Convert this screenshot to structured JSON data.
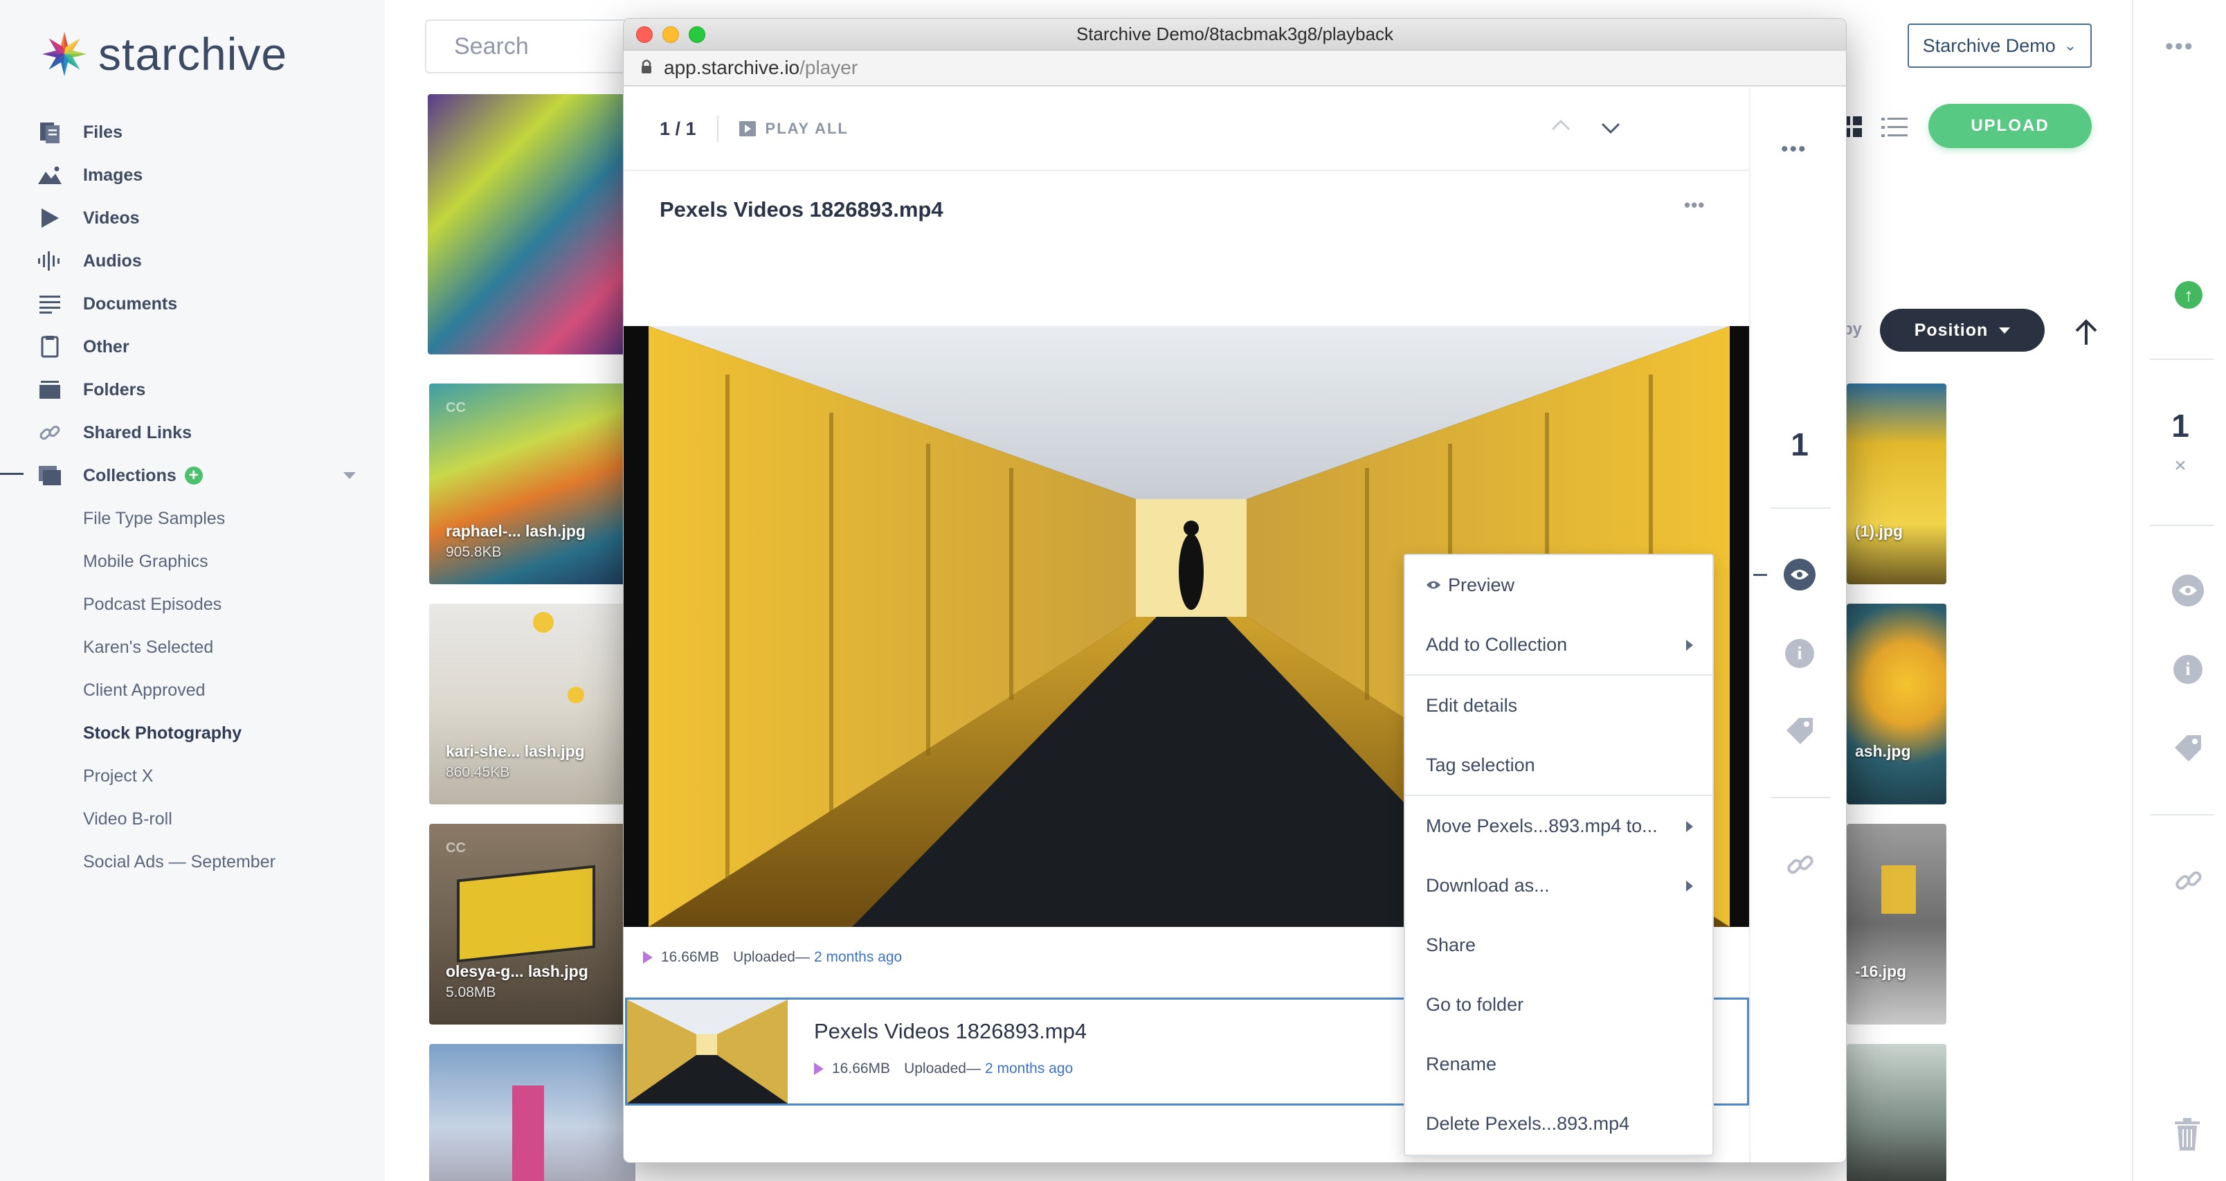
{
  "app": {
    "brand": "starchive"
  },
  "sidebar": {
    "items": [
      {
        "label": "Files",
        "icon": "files-icon"
      },
      {
        "label": "Images",
        "icon": "images-icon"
      },
      {
        "label": "Videos",
        "icon": "videos-icon"
      },
      {
        "label": "Audios",
        "icon": "audios-icon"
      },
      {
        "label": "Documents",
        "icon": "documents-icon"
      },
      {
        "label": "Other",
        "icon": "other-icon"
      },
      {
        "label": "Folders",
        "icon": "folders-icon"
      },
      {
        "label": "Shared Links",
        "icon": "link-icon"
      },
      {
        "label": "Collections",
        "icon": "collections-icon"
      }
    ],
    "collections": [
      "File Type Samples",
      "Mobile Graphics",
      "Podcast Episodes",
      "Karen's Selected",
      "Client Approved",
      "Stock Photography",
      "Project X",
      "Video B-roll",
      "Social Ads — September"
    ]
  },
  "header": {
    "search_placeholder": "Search",
    "workspace": "Starchive Demo",
    "upload": "UPLOAD",
    "sort_by": "by",
    "sort_value": "Position"
  },
  "tiles": [
    {
      "name": "raphael-... lash.jpg",
      "size": "905.8KB",
      "cc": "CC"
    },
    {
      "name": "kari-she... lash.jpg",
      "size": "860.45KB",
      "cc": ""
    },
    {
      "name": "olesya-g... lash.jpg",
      "size": "5.08MB",
      "cc": "CC"
    },
    {
      "name": "(1).jpg"
    },
    {
      "name": "ash.jpg"
    },
    {
      "name": "-16.jpg"
    }
  ],
  "rightbar": {
    "count": "1"
  },
  "window": {
    "title": "Starchive Demo/8tacbmak3g8/playback",
    "url_host": "app.starchive.io",
    "url_path": "/player"
  },
  "player": {
    "counter": "1 / 1",
    "play_all": "PLAY ALL",
    "title": "Pexels Videos 1826893.mp4",
    "size": "16.66MB",
    "uploaded_label": "Uploaded—",
    "uploaded_when": "2 months ago",
    "side_count": "1"
  },
  "menu": {
    "items": [
      {
        "label": "Preview"
      },
      {
        "label": "Add to Collection"
      },
      {
        "label": "Edit details"
      },
      {
        "label": "Tag selection"
      },
      {
        "label": "Move Pexels...893.mp4 to..."
      },
      {
        "label": "Download as..."
      },
      {
        "label": "Share"
      },
      {
        "label": "Go to folder"
      },
      {
        "label": "Rename"
      },
      {
        "label": "Delete Pexels...893.mp4"
      }
    ]
  },
  "colors": {
    "accent_green": "#57c983",
    "link_blue": "#3b74c6",
    "play_purple": "#b978e0"
  }
}
